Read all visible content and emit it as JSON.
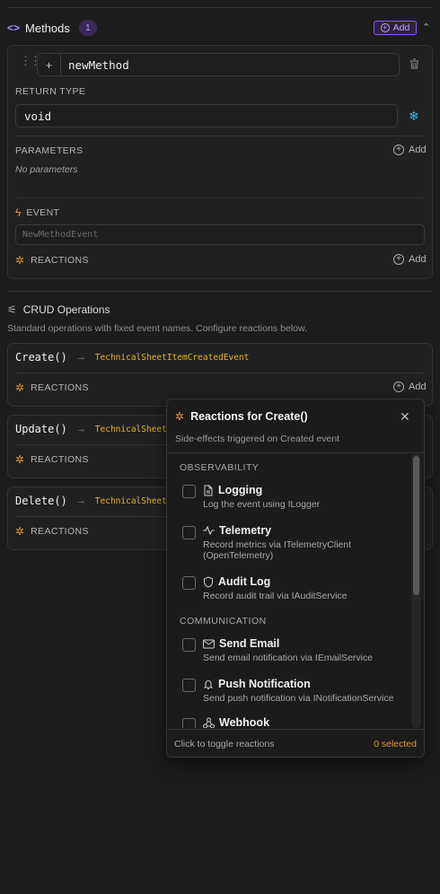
{
  "methods": {
    "title": "Methods",
    "count": "1",
    "add_label": "Add",
    "method": {
      "name": "newMethod",
      "plus": "+",
      "return_type_label": "RETURN TYPE",
      "return_type_value": "void",
      "parameters_label": "PARAMETERS",
      "parameters_add": "Add",
      "no_parameters": "No parameters",
      "event_label": "EVENT",
      "event_placeholder": "NewMethodEvent",
      "reactions_label": "REACTIONS",
      "reactions_add": "Add"
    }
  },
  "crud": {
    "title": "CRUD Operations",
    "description": "Standard operations with fixed event names. Configure reactions below.",
    "operations": [
      {
        "name": "Create()",
        "event": "TechnicalSheetItemCreatedEvent",
        "reactions_label": "REACTIONS",
        "add": "Add"
      },
      {
        "name": "Update()",
        "event": "TechnicalSheetIt",
        "reactions_label": "REACTIONS"
      },
      {
        "name": "Delete()",
        "event": "TechnicalSheetIt",
        "reactions_label": "REACTIONS"
      }
    ]
  },
  "popover": {
    "title": "Reactions for Create()",
    "subtitle": "Side-effects triggered on Created event",
    "sections": [
      {
        "heading": "OBSERVABILITY",
        "items": [
          {
            "icon": "document-icon",
            "title": "Logging",
            "desc": "Log the event using ILogger"
          },
          {
            "icon": "pulse-icon",
            "title": "Telemetry",
            "desc": "Record metrics via ITelemetryClient (OpenTelemetry)"
          },
          {
            "icon": "shield-icon",
            "title": "Audit Log",
            "desc": "Record audit trail via IAuditService"
          }
        ]
      },
      {
        "heading": "COMMUNICATION",
        "items": [
          {
            "icon": "mail-icon",
            "title": "Send Email",
            "desc": "Send email notification via IEmailService"
          },
          {
            "icon": "bell-icon",
            "title": "Push Notification",
            "desc": "Send push notification via INotificationService"
          },
          {
            "icon": "webhook-icon",
            "title": "Webhook",
            "desc": ""
          }
        ]
      }
    ],
    "footer_hint": "Click to toggle reactions",
    "footer_selected": "0 selected"
  },
  "colors": {
    "accent_purple": "#8b5cf6",
    "accent_orange": "#e39a2e",
    "event_yellow": "#e0b12a",
    "snowflake_blue": "#3fb6e6"
  }
}
